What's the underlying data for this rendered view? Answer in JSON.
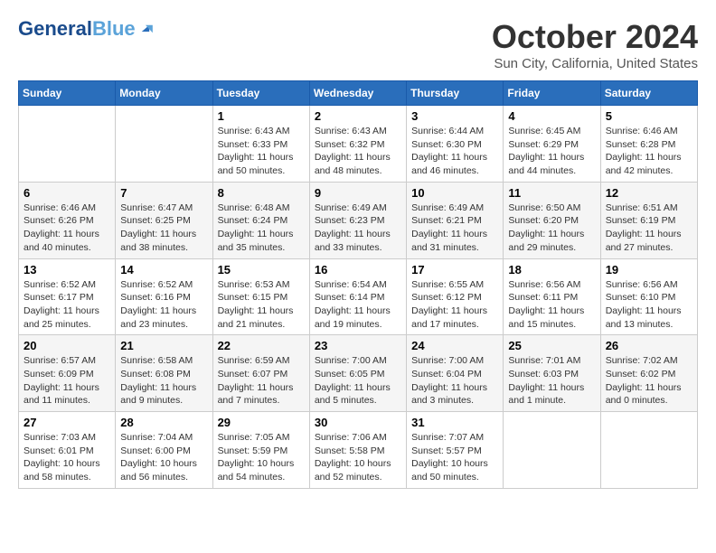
{
  "header": {
    "logo_line1": "General",
    "logo_line2": "Blue",
    "title": "October 2024",
    "subtitle": "Sun City, California, United States"
  },
  "weekdays": [
    "Sunday",
    "Monday",
    "Tuesday",
    "Wednesday",
    "Thursday",
    "Friday",
    "Saturday"
  ],
  "weeks": [
    [
      {
        "day": "",
        "info": ""
      },
      {
        "day": "",
        "info": ""
      },
      {
        "day": "1",
        "info": "Sunrise: 6:43 AM\nSunset: 6:33 PM\nDaylight: 11 hours and 50 minutes."
      },
      {
        "day": "2",
        "info": "Sunrise: 6:43 AM\nSunset: 6:32 PM\nDaylight: 11 hours and 48 minutes."
      },
      {
        "day": "3",
        "info": "Sunrise: 6:44 AM\nSunset: 6:30 PM\nDaylight: 11 hours and 46 minutes."
      },
      {
        "day": "4",
        "info": "Sunrise: 6:45 AM\nSunset: 6:29 PM\nDaylight: 11 hours and 44 minutes."
      },
      {
        "day": "5",
        "info": "Sunrise: 6:46 AM\nSunset: 6:28 PM\nDaylight: 11 hours and 42 minutes."
      }
    ],
    [
      {
        "day": "6",
        "info": "Sunrise: 6:46 AM\nSunset: 6:26 PM\nDaylight: 11 hours and 40 minutes."
      },
      {
        "day": "7",
        "info": "Sunrise: 6:47 AM\nSunset: 6:25 PM\nDaylight: 11 hours and 38 minutes."
      },
      {
        "day": "8",
        "info": "Sunrise: 6:48 AM\nSunset: 6:24 PM\nDaylight: 11 hours and 35 minutes."
      },
      {
        "day": "9",
        "info": "Sunrise: 6:49 AM\nSunset: 6:23 PM\nDaylight: 11 hours and 33 minutes."
      },
      {
        "day": "10",
        "info": "Sunrise: 6:49 AM\nSunset: 6:21 PM\nDaylight: 11 hours and 31 minutes."
      },
      {
        "day": "11",
        "info": "Sunrise: 6:50 AM\nSunset: 6:20 PM\nDaylight: 11 hours and 29 minutes."
      },
      {
        "day": "12",
        "info": "Sunrise: 6:51 AM\nSunset: 6:19 PM\nDaylight: 11 hours and 27 minutes."
      }
    ],
    [
      {
        "day": "13",
        "info": "Sunrise: 6:52 AM\nSunset: 6:17 PM\nDaylight: 11 hours and 25 minutes."
      },
      {
        "day": "14",
        "info": "Sunrise: 6:52 AM\nSunset: 6:16 PM\nDaylight: 11 hours and 23 minutes."
      },
      {
        "day": "15",
        "info": "Sunrise: 6:53 AM\nSunset: 6:15 PM\nDaylight: 11 hours and 21 minutes."
      },
      {
        "day": "16",
        "info": "Sunrise: 6:54 AM\nSunset: 6:14 PM\nDaylight: 11 hours and 19 minutes."
      },
      {
        "day": "17",
        "info": "Sunrise: 6:55 AM\nSunset: 6:12 PM\nDaylight: 11 hours and 17 minutes."
      },
      {
        "day": "18",
        "info": "Sunrise: 6:56 AM\nSunset: 6:11 PM\nDaylight: 11 hours and 15 minutes."
      },
      {
        "day": "19",
        "info": "Sunrise: 6:56 AM\nSunset: 6:10 PM\nDaylight: 11 hours and 13 minutes."
      }
    ],
    [
      {
        "day": "20",
        "info": "Sunrise: 6:57 AM\nSunset: 6:09 PM\nDaylight: 11 hours and 11 minutes."
      },
      {
        "day": "21",
        "info": "Sunrise: 6:58 AM\nSunset: 6:08 PM\nDaylight: 11 hours and 9 minutes."
      },
      {
        "day": "22",
        "info": "Sunrise: 6:59 AM\nSunset: 6:07 PM\nDaylight: 11 hours and 7 minutes."
      },
      {
        "day": "23",
        "info": "Sunrise: 7:00 AM\nSunset: 6:05 PM\nDaylight: 11 hours and 5 minutes."
      },
      {
        "day": "24",
        "info": "Sunrise: 7:00 AM\nSunset: 6:04 PM\nDaylight: 11 hours and 3 minutes."
      },
      {
        "day": "25",
        "info": "Sunrise: 7:01 AM\nSunset: 6:03 PM\nDaylight: 11 hours and 1 minute."
      },
      {
        "day": "26",
        "info": "Sunrise: 7:02 AM\nSunset: 6:02 PM\nDaylight: 11 hours and 0 minutes."
      }
    ],
    [
      {
        "day": "27",
        "info": "Sunrise: 7:03 AM\nSunset: 6:01 PM\nDaylight: 10 hours and 58 minutes."
      },
      {
        "day": "28",
        "info": "Sunrise: 7:04 AM\nSunset: 6:00 PM\nDaylight: 10 hours and 56 minutes."
      },
      {
        "day": "29",
        "info": "Sunrise: 7:05 AM\nSunset: 5:59 PM\nDaylight: 10 hours and 54 minutes."
      },
      {
        "day": "30",
        "info": "Sunrise: 7:06 AM\nSunset: 5:58 PM\nDaylight: 10 hours and 52 minutes."
      },
      {
        "day": "31",
        "info": "Sunrise: 7:07 AM\nSunset: 5:57 PM\nDaylight: 10 hours and 50 minutes."
      },
      {
        "day": "",
        "info": ""
      },
      {
        "day": "",
        "info": ""
      }
    ]
  ]
}
